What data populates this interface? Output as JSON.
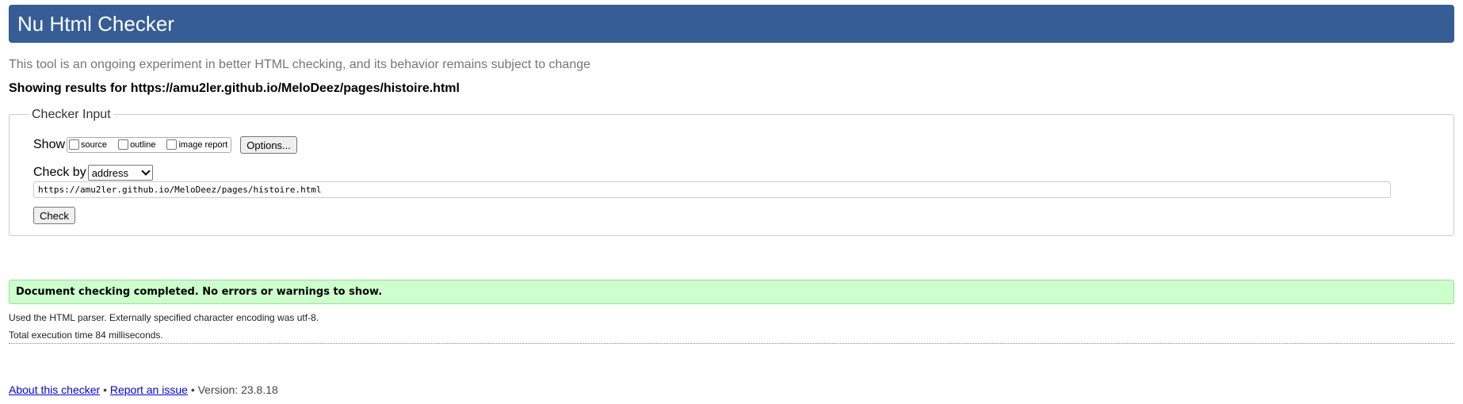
{
  "header": {
    "title": "Nu Html Checker"
  },
  "intro": "This tool is an ongoing experiment in better HTML checking, and its behavior remains subject to change",
  "showing": "Showing results for https://amu2ler.github.io/MeloDeez/pages/histoire.html",
  "checker_input": {
    "legend": "Checker Input",
    "show_label": "Show",
    "show_options": [
      {
        "label": "source",
        "checked": false
      },
      {
        "label": "outline",
        "checked": false
      },
      {
        "label": "image report",
        "checked": false
      }
    ],
    "options_button": "Options...",
    "check_by_label": "Check by",
    "check_by_value": "address",
    "url_value": "https://amu2ler.github.io/MeloDeez/pages/histoire.html",
    "check_button": "Check"
  },
  "result": {
    "message": "Document checking completed. No errors or warnings to show.",
    "parser_info": "Used the HTML parser. Externally specified character encoding was utf-8.",
    "execution_time": "Total execution time 84 milliseconds."
  },
  "footer": {
    "about_link": "About this checker",
    "separator": "•",
    "report_link": "Report an issue",
    "version": "• Version: 23.8.18"
  },
  "colors": {
    "header_bg": "#365d95",
    "success_bg": "#ccffcc",
    "link": "#0000ee"
  }
}
